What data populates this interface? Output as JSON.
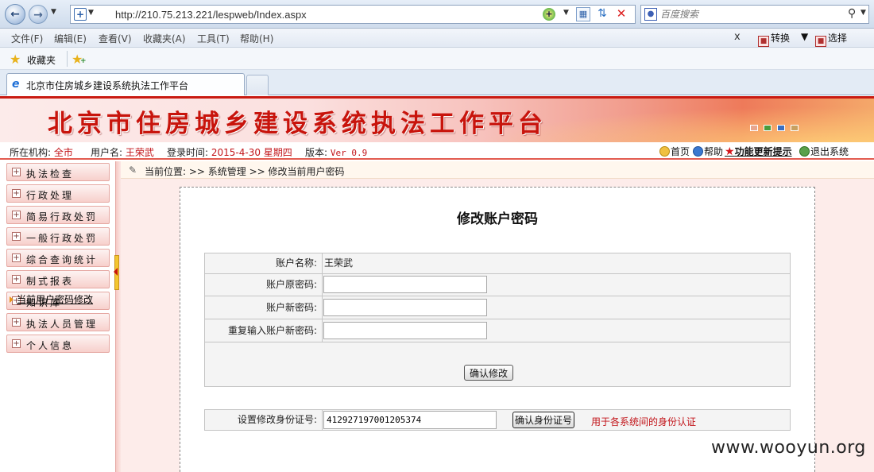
{
  "browser": {
    "url": "http://210.75.213.221/lespweb/Index.aspx",
    "search_placeholder": "百度搜索",
    "menu": [
      "文件(F)",
      "编辑(E)",
      "查看(V)",
      "收藏夹(A)",
      "工具(T)",
      "帮助(H)"
    ],
    "menu_close": "x",
    "tools": {
      "convert": "转换",
      "select": "选择"
    },
    "favorites_label": "收藏夹",
    "tab_title": "北京市住房城乡建设系统执法工作平台"
  },
  "banner": {
    "title": "北京市住房城乡建设系统执法工作平台"
  },
  "info": {
    "org_label": "所在机构:",
    "org_value": "全市",
    "user_label": "用户名:",
    "user_value": "王荣武",
    "login_label": "登录时间:",
    "login_value": "2015-4-30 星期四",
    "version_label": "版本:",
    "version_value": "Ver 0.9",
    "links": {
      "home": "首页",
      "help": "帮助",
      "updates": "功能更新提示",
      "logout": "退出系统"
    }
  },
  "sidebar": {
    "items": [
      "执法检查",
      "行政处理",
      "简易行政处罚",
      "一般行政处罚",
      "综合查询统计",
      "制式报表",
      "知识库",
      "执法人员管理",
      "个人信息"
    ],
    "active_sub": "当前用户密码修改"
  },
  "breadcrumb": "当前位置: >> 系统管理 >> 修改当前用户密码",
  "form": {
    "title": "修改账户密码",
    "account_name_label": "账户名称:",
    "account_name_value": "王荣武",
    "old_password_label": "账户原密码:",
    "new_password_label": "账户新密码:",
    "repeat_password_label": "重复输入账户新密码:",
    "confirm_label": "确认修改",
    "id_label": "设置修改身份证号:",
    "id_value": "412927197001205374",
    "id_confirm_label": "确认身份证号",
    "id_hint": "用于各系统间的身份认证"
  },
  "watermark": "www.wooyun.org",
  "colors": {
    "brand_red": "#c8140c",
    "accent_red": "#c2151a",
    "panel_bg": "#fdecea"
  }
}
